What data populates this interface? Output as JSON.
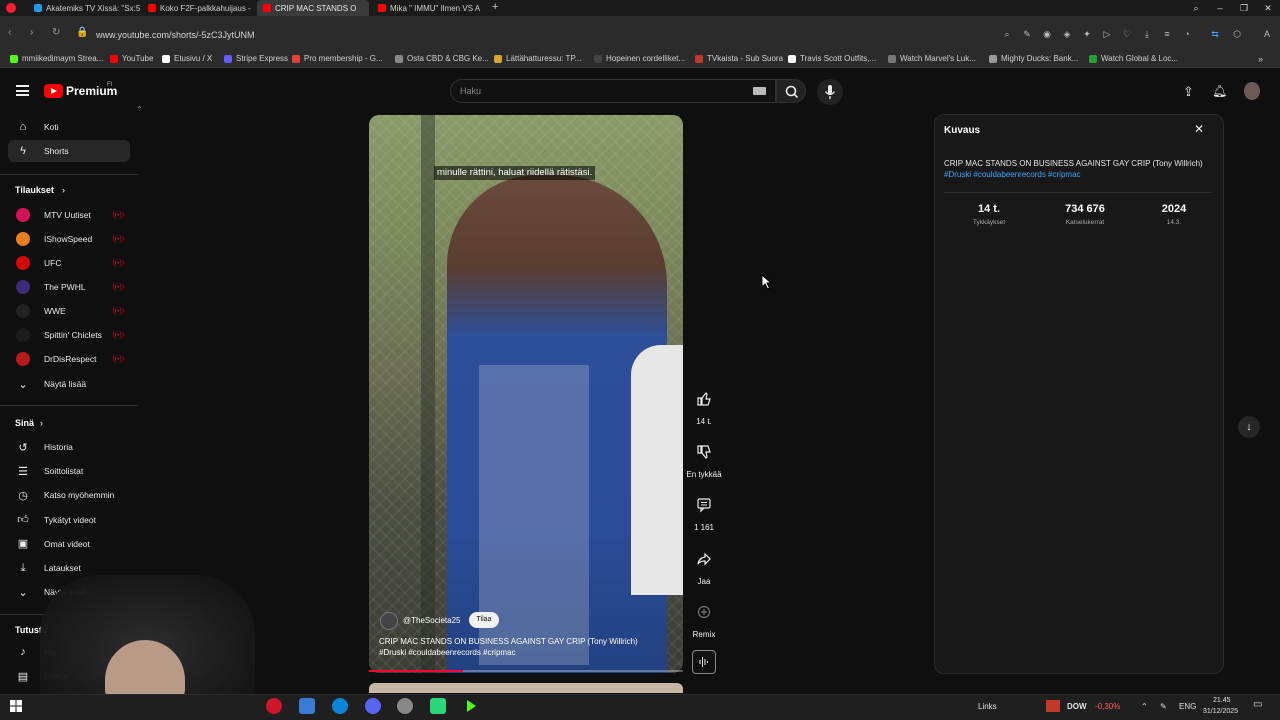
{
  "browser": {
    "tabs": [
      {
        "label": "Akatemiks TV Xissä: \"Sx:5",
        "color": "#1d9bf0",
        "icon": "x-logo"
      },
      {
        "label": "Koko F2F-palkkahuijaus -",
        "color": "#ff0000",
        "icon": "youtube"
      },
      {
        "label": "CRIP MAC STANDS O",
        "color": "#ff0000",
        "icon": "youtube-audio"
      },
      {
        "label": "Mika \" IMMU\" Ilmen VS A",
        "color": "#ff0000",
        "icon": "youtube"
      }
    ],
    "url": "www.youtube.com/shorts/-5zC3JytUNM",
    "bookmarks": [
      {
        "label": "mmiikedimaym Strea...",
        "color": "#53fc18"
      },
      {
        "label": "YouTube",
        "color": "#ff0000"
      },
      {
        "label": "Etusivu / X",
        "color": "#ffffff"
      },
      {
        "label": "Stripe Express",
        "color": "#635bff"
      },
      {
        "label": "Pro membership - G...",
        "color": "#ea4335"
      },
      {
        "label": "Osta CBD & CBG Ke...",
        "color": "#888888"
      },
      {
        "label": "Lättähatturessu: TP...",
        "color": "#d4a72c"
      },
      {
        "label": "Hopeinen cordelliket...",
        "color": "#444444"
      },
      {
        "label": "TVkaista - Sub Suora",
        "color": "#c0392b"
      },
      {
        "label": "Travis Scott Outfits,...",
        "color": "#ffffff"
      },
      {
        "label": "Watch Marvel's Luk...",
        "color": "#777777"
      },
      {
        "label": "Mighty Ducks: Bank...",
        "color": "#999999"
      },
      {
        "label": "Watch Global & Loc...",
        "color": "#22a336"
      }
    ]
  },
  "youtube": {
    "logo_text": "Premium",
    "logo_sup": "FI",
    "search_placeholder": "Haku"
  },
  "sidebar": {
    "main": [
      {
        "label": "Koti",
        "icon": "home-icon"
      },
      {
        "label": "Shorts",
        "icon": "shorts-icon"
      }
    ],
    "subs_header": "Tilaukset",
    "subs": [
      {
        "label": "MTV Uutiset",
        "color": "#d4145a"
      },
      {
        "label": "IShowSpeed",
        "color": "#e67e22"
      },
      {
        "label": "UFC",
        "color": "#d20a0a"
      },
      {
        "label": "The PWHL",
        "color": "#3b2a7a"
      },
      {
        "label": "WWE",
        "color": "#222222"
      },
      {
        "label": "Spittin' Chiclets",
        "color": "#1c1c1c"
      },
      {
        "label": "DrDisRespect",
        "color": "#b71c1c"
      }
    ],
    "subs_more": "Näytä lisää",
    "you_header": "Sinä",
    "you": [
      {
        "label": "Historia",
        "icon": "history-icon"
      },
      {
        "label": "Soittolistat",
        "icon": "playlist-icon"
      },
      {
        "label": "Katso myöhemmin",
        "icon": "watch-later-icon"
      },
      {
        "label": "Tykätyt videot",
        "icon": "like-icon"
      },
      {
        "label": "Omat videot",
        "icon": "my-videos-icon"
      },
      {
        "label": "Lataukset",
        "icon": "download-icon"
      },
      {
        "label": "Näytä lisää",
        "icon": "chevron-down-icon"
      }
    ],
    "explore_header": "Tutustu",
    "explore": [
      {
        "label": "Mu",
        "icon": "music-icon"
      },
      {
        "label": "Elokuv",
        "icon": "film-icon"
      }
    ]
  },
  "short": {
    "subtitle": "minulle rättini, haluat riidellä rätistäsi.",
    "channel": "@TheSocieta25",
    "subscribe": "Tilaa",
    "title": "CRIP MAC STANDS ON BUSINESS AGAINST GAY CRIP (Tony Willrich)",
    "tags": "#Druski #couldabeenrecords #cripmac",
    "progress": 0.3
  },
  "actions": {
    "like_count": "14 t.",
    "dislike_label": "En tykkää",
    "comment_count": "1 161",
    "share_label": "Jaa",
    "remix_label": "Remix"
  },
  "panel": {
    "title": "Kuvaus",
    "description": "CRIP MAC STANDS ON BUSINESS AGAINST GAY CRIP (Tony Willrich)",
    "tags": "#Druski #couldabeenrecords #cripmac",
    "stats": [
      {
        "value": "14 t.",
        "label": "Tykkäykset"
      },
      {
        "value": "734 676",
        "label": "Katselukerrat"
      },
      {
        "value": "2024",
        "label": "14.3."
      }
    ]
  },
  "taskbar": {
    "links": "Links",
    "ticker": "DOW",
    "ticker_change": "-0,30%",
    "lang": "ENG",
    "time": "21.45",
    "date": "31/12/2025"
  }
}
